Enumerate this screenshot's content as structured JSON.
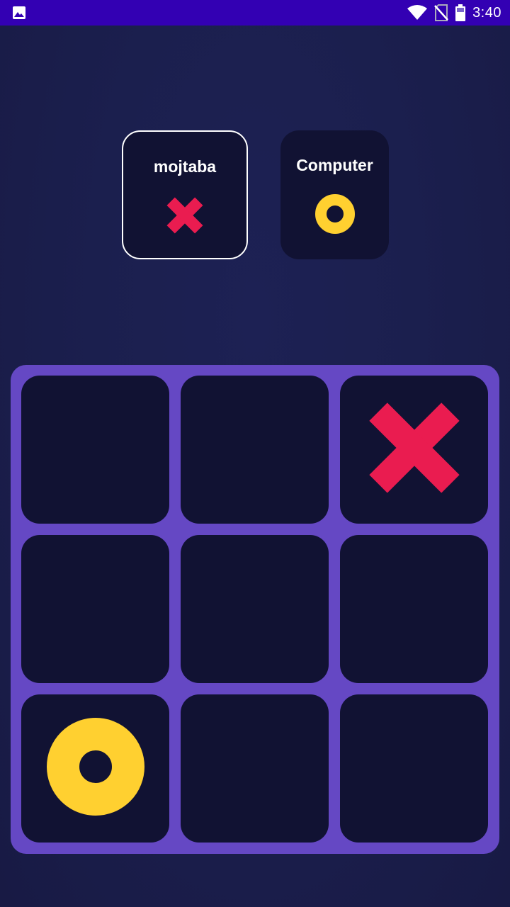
{
  "status_bar": {
    "time": "3:40",
    "icons": [
      "image-notification-icon",
      "wifi-icon",
      "no-sim-icon",
      "battery-icon"
    ]
  },
  "players": [
    {
      "name": "mojtaba",
      "symbol": "X",
      "active": true
    },
    {
      "name": "Computer",
      "symbol": "O",
      "active": false
    }
  ],
  "board": {
    "cells": [
      "",
      "",
      "X",
      "",
      "",
      "",
      "O",
      "",
      ""
    ]
  },
  "colors": {
    "status_bar": "#3300b3",
    "background": "#1b1f4e",
    "card": "#111233",
    "board": "#6548c4",
    "x_mark": "#ea1c50",
    "o_mark": "#ffd030"
  }
}
